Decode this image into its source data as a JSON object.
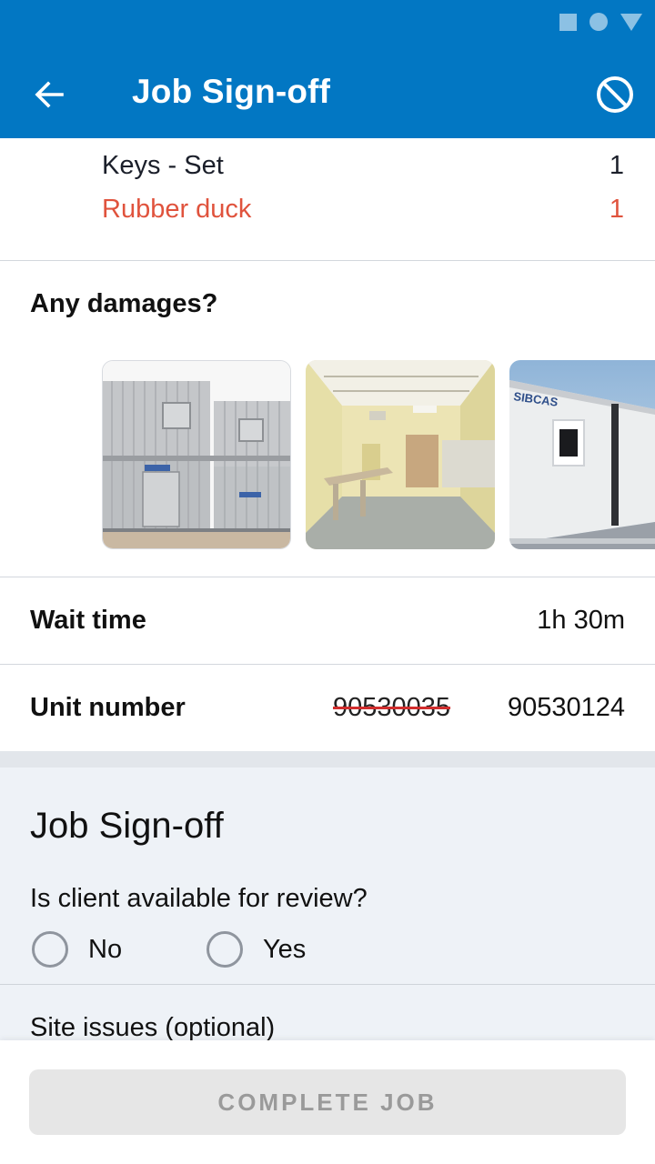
{
  "appbar": {
    "title": "Job Sign-off",
    "color": "#0277c3",
    "back_icon": "arrow-left-icon",
    "cancel_icon": "block-icon"
  },
  "status_bar": {
    "icons": [
      "square-icon",
      "circle-icon",
      "triangle-icon"
    ]
  },
  "items": [
    {
      "name": "Keys - Set",
      "qty": "1",
      "color": "#1b1f2a"
    },
    {
      "name": "Rubber duck",
      "qty": "1",
      "color": "#e0533d"
    }
  ],
  "damages": {
    "label": "Any damages?",
    "photos": [
      "photo-stacked-containers",
      "photo-interior-room",
      "photo-sibcas-unit"
    ]
  },
  "wait_time": {
    "label": "Wait time",
    "value": "1h 30m"
  },
  "unit_number": {
    "label": "Unit number",
    "old_value": "90530035",
    "new_value": "90530124"
  },
  "signoff": {
    "title": "Job Sign-off",
    "question": "Is client available for review?",
    "options": [
      "No",
      "Yes"
    ],
    "site_issues_label": "Site issues (optional)"
  },
  "footer": {
    "complete_label": "COMPLETE JOB"
  }
}
